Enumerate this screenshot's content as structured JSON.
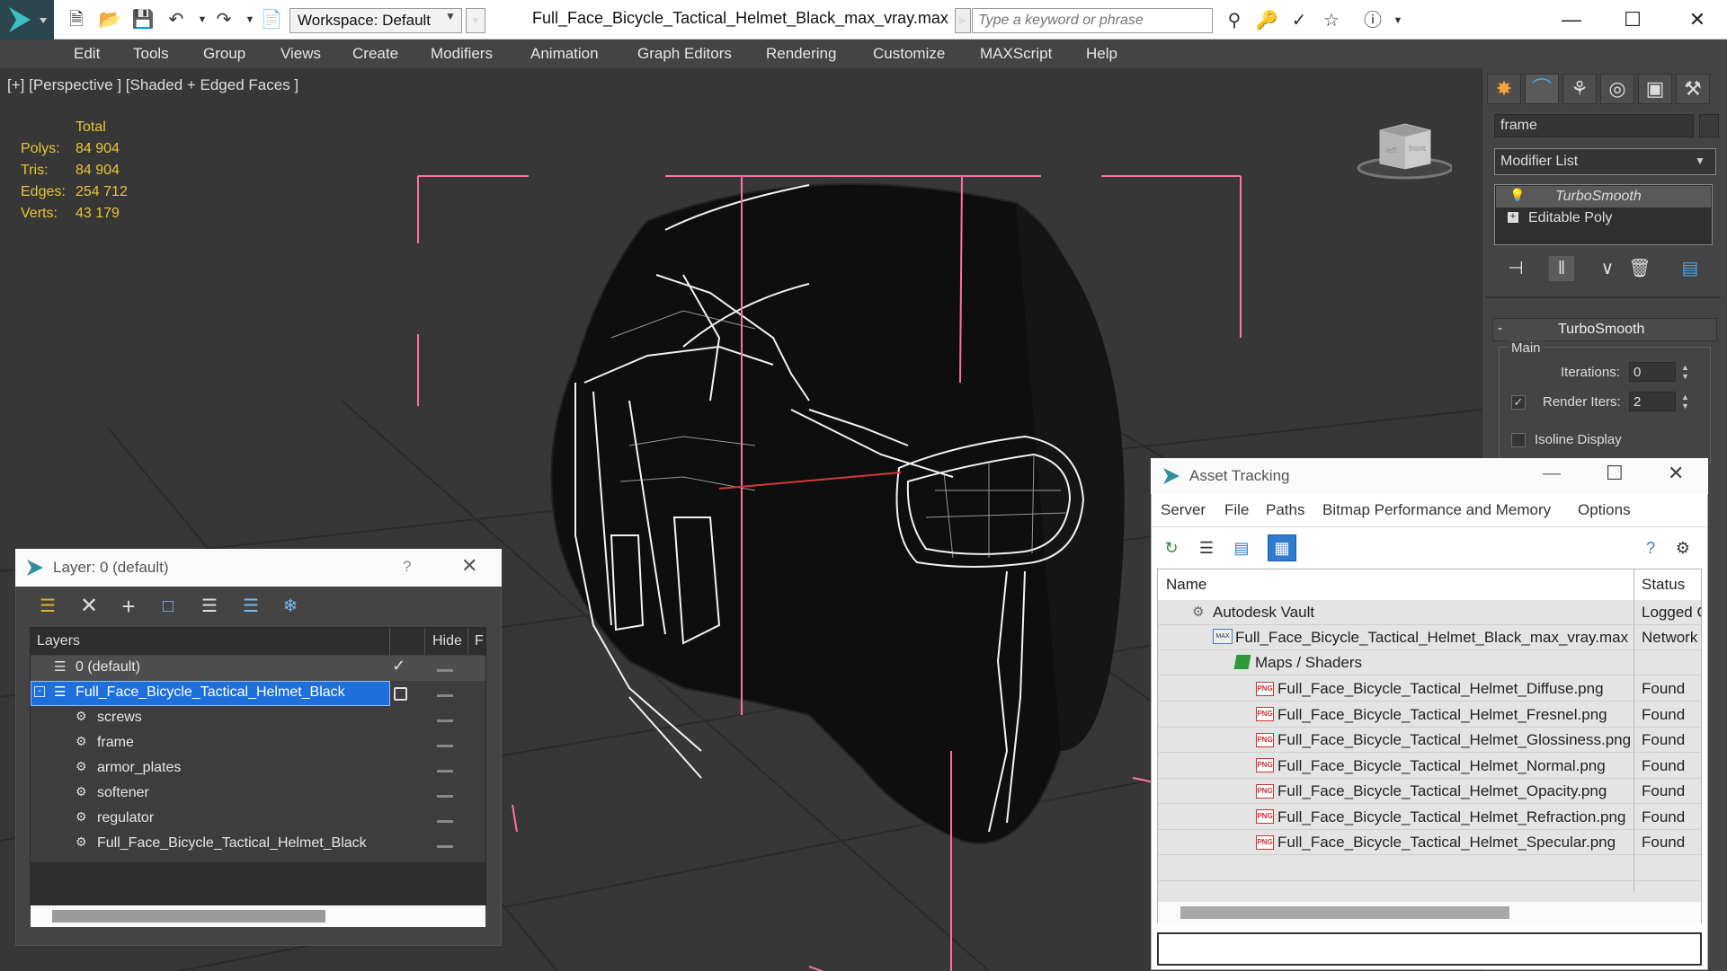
{
  "titlebar": {
    "workspace": "Workspace: Default",
    "document_title": "Full_Face_Bicycle_Tactical_Helmet_Black_max_vray.max",
    "search_placeholder": "Type a keyword or phrase"
  },
  "menu": [
    "Edit",
    "Tools",
    "Group",
    "Views",
    "Create",
    "Modifiers",
    "Animation",
    "Graph Editors",
    "Rendering",
    "Customize",
    "MAXScript",
    "Help"
  ],
  "viewport": {
    "label": "[+] [Perspective ] [Shaded + Edged Faces ]",
    "stats": {
      "header": "Total",
      "rows": [
        {
          "label": "Polys:",
          "value": "84 904"
        },
        {
          "label": "Tris:",
          "value": "84 904"
        },
        {
          "label": "Edges:",
          "value": "254 712"
        },
        {
          "label": "Verts:",
          "value": "43 179"
        }
      ]
    },
    "viewcube_faces": [
      "left",
      "front"
    ]
  },
  "command_panel": {
    "object_name": "frame",
    "modifier_list": "Modifier List",
    "stack": [
      "TurboSmooth",
      "Editable Poly"
    ],
    "rollout_title": "TurboSmooth",
    "main_group": "Main",
    "iterations_label": "Iterations:",
    "iterations_value": "0",
    "render_iters_label": "Render Iters:",
    "render_iters_value": "2",
    "render_iters_checked": true,
    "isoline_label": "Isoline Display"
  },
  "layer_dialog": {
    "title": "Layer: 0 (default)",
    "help": "?",
    "col_layers": "Layers",
    "col_hide": "Hide",
    "col_f": "F",
    "rows": [
      {
        "name": "0 (default)",
        "level": 0,
        "type": "layer",
        "checked": true
      },
      {
        "name": "Full_Face_Bicycle_Tactical_Helmet_Black",
        "level": 0,
        "type": "layer",
        "selected": true
      },
      {
        "name": "screws",
        "level": 1,
        "type": "object"
      },
      {
        "name": "frame",
        "level": 1,
        "type": "object"
      },
      {
        "name": "armor_plates",
        "level": 1,
        "type": "object"
      },
      {
        "name": "softener",
        "level": 1,
        "type": "object"
      },
      {
        "name": "regulator",
        "level": 1,
        "type": "object"
      },
      {
        "name": "Full_Face_Bicycle_Tactical_Helmet_Black",
        "level": 1,
        "type": "object"
      }
    ]
  },
  "asset_tracking": {
    "title": "Asset Tracking",
    "menu": [
      "Server",
      "File",
      "Paths",
      "Bitmap Performance and Memory",
      "Options"
    ],
    "col_name": "Name",
    "col_status": "Status",
    "rows": [
      {
        "name": "Autodesk Vault",
        "status": "Logged C",
        "level": 0,
        "icon": "vault-icon"
      },
      {
        "name": "Full_Face_Bicycle_Tactical_Helmet_Black_max_vray.max",
        "status": "Network",
        "level": 1,
        "icon": "max-file-icon"
      },
      {
        "name": "Maps / Shaders",
        "status": "",
        "level": 2,
        "icon": "maps-icon"
      },
      {
        "name": "Full_Face_Bicycle_Tactical_Helmet_Diffuse.png",
        "status": "Found",
        "level": 3,
        "icon": "png-icon"
      },
      {
        "name": "Full_Face_Bicycle_Tactical_Helmet_Fresnel.png",
        "status": "Found",
        "level": 3,
        "icon": "png-icon"
      },
      {
        "name": "Full_Face_Bicycle_Tactical_Helmet_Glossiness.png",
        "status": "Found",
        "level": 3,
        "icon": "png-icon"
      },
      {
        "name": "Full_Face_Bicycle_Tactical_Helmet_Normal.png",
        "status": "Found",
        "level": 3,
        "icon": "png-icon"
      },
      {
        "name": "Full_Face_Bicycle_Tactical_Helmet_Opacity.png",
        "status": "Found",
        "level": 3,
        "icon": "png-icon"
      },
      {
        "name": "Full_Face_Bicycle_Tactical_Helmet_Refraction.png",
        "status": "Found",
        "level": 3,
        "icon": "png-icon"
      },
      {
        "name": "Full_Face_Bicycle_Tactical_Helmet_Specular.png",
        "status": "Found",
        "level": 3,
        "icon": "png-icon"
      }
    ]
  },
  "colors": {
    "stats_yellow": "#e8c533",
    "selection_blue": "#1e6fd9",
    "bbox_pink": "#ff6fa8",
    "viewport_bg": "#373737",
    "panel_bg": "#444444"
  }
}
